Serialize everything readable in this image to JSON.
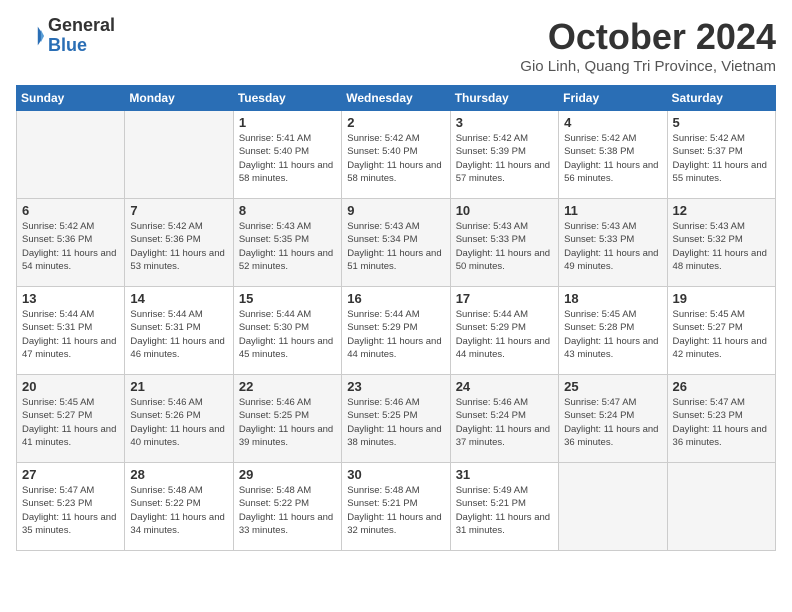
{
  "header": {
    "logo_general": "General",
    "logo_blue": "Blue",
    "title": "October 2024",
    "location": "Gio Linh, Quang Tri Province, Vietnam"
  },
  "days_of_week": [
    "Sunday",
    "Monday",
    "Tuesday",
    "Wednesday",
    "Thursday",
    "Friday",
    "Saturday"
  ],
  "weeks": [
    [
      {
        "day": "",
        "empty": true
      },
      {
        "day": "",
        "empty": true
      },
      {
        "day": "1",
        "sunrise": "5:41 AM",
        "sunset": "5:40 PM",
        "daylight": "11 hours and 58 minutes."
      },
      {
        "day": "2",
        "sunrise": "5:42 AM",
        "sunset": "5:40 PM",
        "daylight": "11 hours and 58 minutes."
      },
      {
        "day": "3",
        "sunrise": "5:42 AM",
        "sunset": "5:39 PM",
        "daylight": "11 hours and 57 minutes."
      },
      {
        "day": "4",
        "sunrise": "5:42 AM",
        "sunset": "5:38 PM",
        "daylight": "11 hours and 56 minutes."
      },
      {
        "day": "5",
        "sunrise": "5:42 AM",
        "sunset": "5:37 PM",
        "daylight": "11 hours and 55 minutes."
      }
    ],
    [
      {
        "day": "6",
        "sunrise": "5:42 AM",
        "sunset": "5:36 PM",
        "daylight": "11 hours and 54 minutes."
      },
      {
        "day": "7",
        "sunrise": "5:42 AM",
        "sunset": "5:36 PM",
        "daylight": "11 hours and 53 minutes."
      },
      {
        "day": "8",
        "sunrise": "5:43 AM",
        "sunset": "5:35 PM",
        "daylight": "11 hours and 52 minutes."
      },
      {
        "day": "9",
        "sunrise": "5:43 AM",
        "sunset": "5:34 PM",
        "daylight": "11 hours and 51 minutes."
      },
      {
        "day": "10",
        "sunrise": "5:43 AM",
        "sunset": "5:33 PM",
        "daylight": "11 hours and 50 minutes."
      },
      {
        "day": "11",
        "sunrise": "5:43 AM",
        "sunset": "5:33 PM",
        "daylight": "11 hours and 49 minutes."
      },
      {
        "day": "12",
        "sunrise": "5:43 AM",
        "sunset": "5:32 PM",
        "daylight": "11 hours and 48 minutes."
      }
    ],
    [
      {
        "day": "13",
        "sunrise": "5:44 AM",
        "sunset": "5:31 PM",
        "daylight": "11 hours and 47 minutes."
      },
      {
        "day": "14",
        "sunrise": "5:44 AM",
        "sunset": "5:31 PM",
        "daylight": "11 hours and 46 minutes."
      },
      {
        "day": "15",
        "sunrise": "5:44 AM",
        "sunset": "5:30 PM",
        "daylight": "11 hours and 45 minutes."
      },
      {
        "day": "16",
        "sunrise": "5:44 AM",
        "sunset": "5:29 PM",
        "daylight": "11 hours and 44 minutes."
      },
      {
        "day": "17",
        "sunrise": "5:44 AM",
        "sunset": "5:29 PM",
        "daylight": "11 hours and 44 minutes."
      },
      {
        "day": "18",
        "sunrise": "5:45 AM",
        "sunset": "5:28 PM",
        "daylight": "11 hours and 43 minutes."
      },
      {
        "day": "19",
        "sunrise": "5:45 AM",
        "sunset": "5:27 PM",
        "daylight": "11 hours and 42 minutes."
      }
    ],
    [
      {
        "day": "20",
        "sunrise": "5:45 AM",
        "sunset": "5:27 PM",
        "daylight": "11 hours and 41 minutes."
      },
      {
        "day": "21",
        "sunrise": "5:46 AM",
        "sunset": "5:26 PM",
        "daylight": "11 hours and 40 minutes."
      },
      {
        "day": "22",
        "sunrise": "5:46 AM",
        "sunset": "5:25 PM",
        "daylight": "11 hours and 39 minutes."
      },
      {
        "day": "23",
        "sunrise": "5:46 AM",
        "sunset": "5:25 PM",
        "daylight": "11 hours and 38 minutes."
      },
      {
        "day": "24",
        "sunrise": "5:46 AM",
        "sunset": "5:24 PM",
        "daylight": "11 hours and 37 minutes."
      },
      {
        "day": "25",
        "sunrise": "5:47 AM",
        "sunset": "5:24 PM",
        "daylight": "11 hours and 36 minutes."
      },
      {
        "day": "26",
        "sunrise": "5:47 AM",
        "sunset": "5:23 PM",
        "daylight": "11 hours and 36 minutes."
      }
    ],
    [
      {
        "day": "27",
        "sunrise": "5:47 AM",
        "sunset": "5:23 PM",
        "daylight": "11 hours and 35 minutes."
      },
      {
        "day": "28",
        "sunrise": "5:48 AM",
        "sunset": "5:22 PM",
        "daylight": "11 hours and 34 minutes."
      },
      {
        "day": "29",
        "sunrise": "5:48 AM",
        "sunset": "5:22 PM",
        "daylight": "11 hours and 33 minutes."
      },
      {
        "day": "30",
        "sunrise": "5:48 AM",
        "sunset": "5:21 PM",
        "daylight": "11 hours and 32 minutes."
      },
      {
        "day": "31",
        "sunrise": "5:49 AM",
        "sunset": "5:21 PM",
        "daylight": "11 hours and 31 minutes."
      },
      {
        "day": "",
        "empty": true
      },
      {
        "day": "",
        "empty": true
      }
    ]
  ]
}
